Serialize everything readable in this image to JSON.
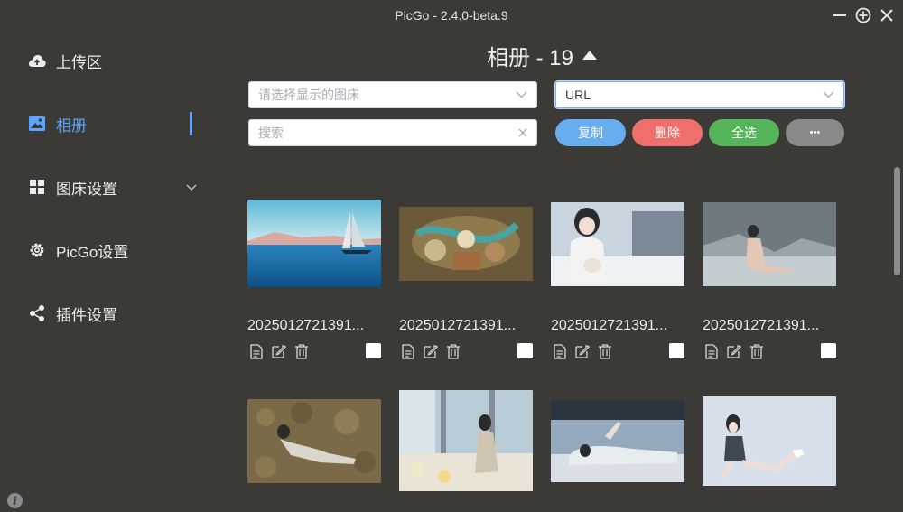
{
  "window": {
    "title": "PicGo - 2.4.0-beta.9"
  },
  "sidebar": {
    "items": [
      {
        "label": "上传区",
        "icon": "cloud-upload-icon"
      },
      {
        "label": "相册",
        "icon": "image-icon",
        "active": true
      },
      {
        "label": "图床设置",
        "icon": "grid-icon"
      },
      {
        "label": "PicGo设置",
        "icon": "gear-icon"
      },
      {
        "label": "插件设置",
        "icon": "share-icon"
      }
    ]
  },
  "gallery": {
    "title": "相册 - 19",
    "picbed_select": {
      "placeholder": "请选择显示的图床"
    },
    "format_select": {
      "value": "URL"
    },
    "search": {
      "placeholder": "搜索"
    },
    "buttons": {
      "copy": "复制",
      "delete": "删除",
      "select_all": "全选",
      "more": "•••"
    },
    "items": [
      {
        "name": "2025012721391..."
      },
      {
        "name": "2025012721391..."
      },
      {
        "name": "2025012721391..."
      },
      {
        "name": "2025012721391..."
      },
      {
        "name": ""
      },
      {
        "name": ""
      },
      {
        "name": ""
      },
      {
        "name": ""
      }
    ]
  },
  "colors": {
    "accent": "#5aa3ff",
    "copy": "#66aef0",
    "delete": "#ef6f6c",
    "select_all": "#55b55a",
    "more": "#8a8a8a",
    "background": "#3b3a36"
  }
}
